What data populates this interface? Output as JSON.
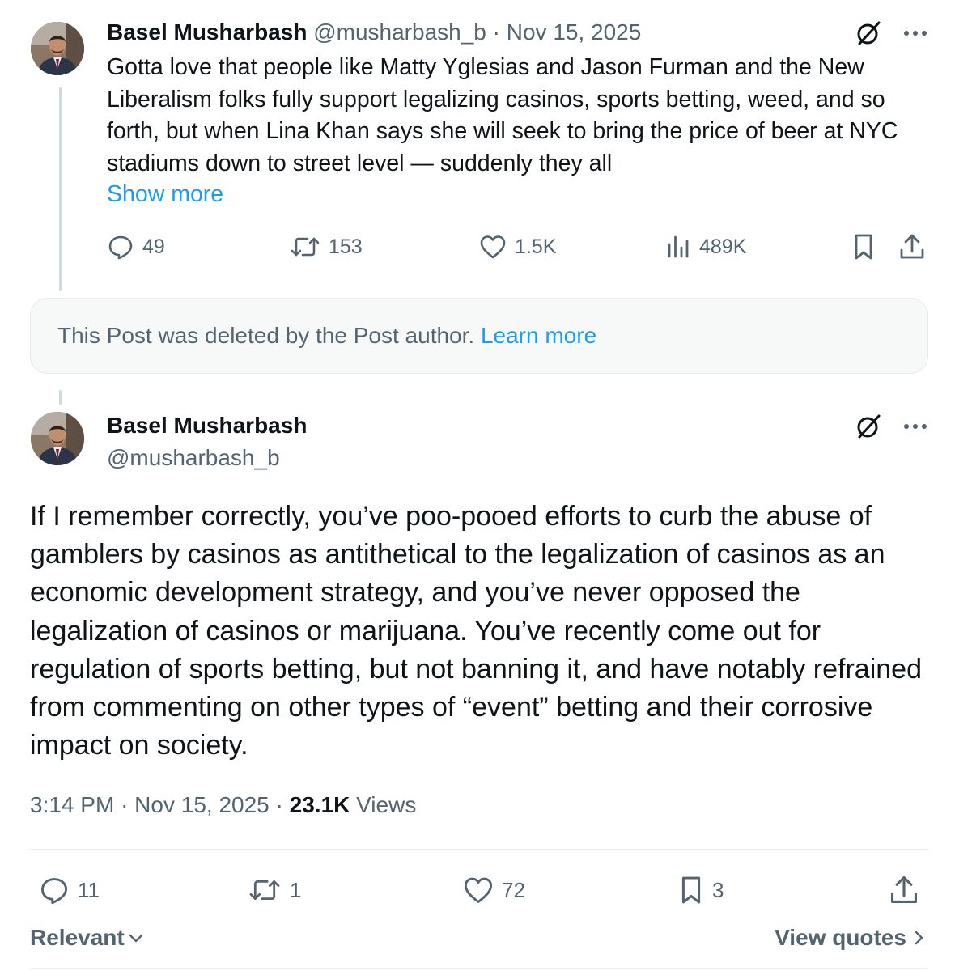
{
  "parent_post": {
    "author_name": "Basel Musharbash",
    "handle": "@musharbash_b",
    "separator": "·",
    "date": "Nov 15, 2025",
    "text": "Gotta love that people like Matty Yglesias and Jason Furman and the New Liberalism folks fully support legalizing casinos, sports betting, weed, and so forth, but when Lina Khan says she will seek to bring the price of beer at NYC stadiums down to street level — suddenly they all",
    "show_more": "Show more",
    "replies": "49",
    "reposts": "153",
    "likes": "1.5K",
    "views": "489K"
  },
  "deleted_notice": {
    "text": "This Post was deleted by the Post author.",
    "link": "Learn more"
  },
  "main_post": {
    "author_name": "Basel Musharbash",
    "handle": "@musharbash_b",
    "text": "If I remember correctly, you’ve poo-pooed efforts to curb the abuse of gamblers by casinos as antithetical to the legalization of casinos as an economic development strategy, and you’ve never opposed the legalization of casinos or marijuana. You’ve recently come out for regulation of sports betting, but not banning it, and have notably refrained from commenting on other types of “event” betting and their corrosive impact on society.",
    "time": "3:14 PM",
    "separator": "·",
    "date": "Nov 15, 2025",
    "views_count": "23.1K",
    "views_label": "Views",
    "replies": "11",
    "reposts": "1",
    "likes": "72",
    "bookmarks": "3"
  },
  "footer": {
    "sort_label": "Relevant",
    "view_quotes": "View quotes"
  },
  "icons": {
    "grok": "grok-icon",
    "more": "more-icon",
    "reply": "reply-icon",
    "repost": "repost-icon",
    "like": "like-icon",
    "views": "views-icon",
    "bookmark": "bookmark-icon",
    "share": "share-icon"
  },
  "colors": {
    "link": "#1d9bf0",
    "muted": "#536471",
    "text": "#0f1419",
    "border": "#e6eaed",
    "thread_line": "#cfd9de"
  }
}
